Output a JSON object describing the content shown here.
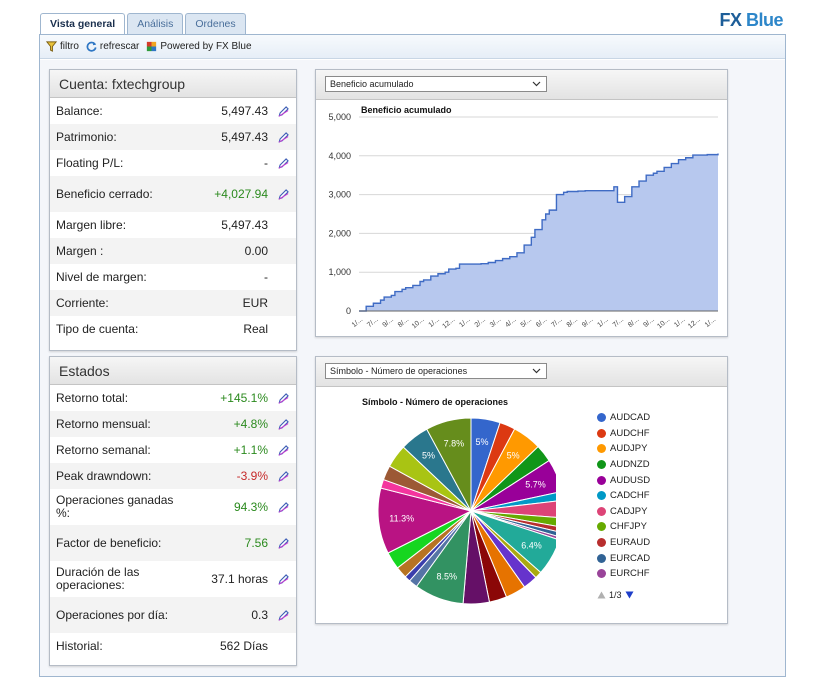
{
  "tabs": [
    {
      "label": "Vista general",
      "active": true
    },
    {
      "label": "Análisis",
      "active": false
    },
    {
      "label": "Ordenes",
      "active": false
    }
  ],
  "brand": {
    "prefix": "FX",
    "name": "Blue"
  },
  "toolbar": {
    "filter": "filtro",
    "refresh": "refrescar",
    "powered": "Powered by FX Blue"
  },
  "account": {
    "title": "Cuenta: fxtechgroup",
    "rows": [
      {
        "label": "Balance:",
        "value": "5,497.43",
        "tone": "",
        "icon": true
      },
      {
        "label": "Patrimonio:",
        "value": "5,497.43",
        "tone": "",
        "icon": true
      },
      {
        "label": "Floating P/L:",
        "value": "-",
        "tone": "",
        "icon": true
      },
      {
        "label": "Beneficio cerrado:",
        "value": "+4,027.94",
        "tone": "pos",
        "icon": true
      },
      {
        "label": "Margen libre:",
        "value": "5,497.43",
        "tone": "",
        "icon": false
      },
      {
        "label": "Margen :",
        "value": "0.00",
        "tone": "",
        "icon": false
      },
      {
        "label": "Nivel de margen:",
        "value": "-",
        "tone": "",
        "icon": false
      },
      {
        "label": "Corriente:",
        "value": "EUR",
        "tone": "",
        "icon": false
      },
      {
        "label": "Tipo de cuenta:",
        "value": "Real",
        "tone": "",
        "icon": false
      }
    ]
  },
  "stats": {
    "title": "Estados",
    "rows": [
      {
        "label": "Retorno total:",
        "value": "+145.1%",
        "tone": "pos",
        "icon": true
      },
      {
        "label": "Retorno mensual:",
        "value": "+4.8%",
        "tone": "pos",
        "icon": true
      },
      {
        "label": "Retorno semanal:",
        "value": "+1.1%",
        "tone": "pos",
        "icon": true
      },
      {
        "label": "Peak drawndown:",
        "value": "-3.9%",
        "tone": "neg",
        "icon": true
      },
      {
        "label": "Operaciones ganadas %:",
        "value": "94.3%",
        "tone": "pos",
        "icon": true
      },
      {
        "label": "Factor de beneficio:",
        "value": "7.56",
        "tone": "pos",
        "icon": true
      },
      {
        "label": "Duración de las operaciones:",
        "value": "37.1 horas",
        "tone": "",
        "icon": true
      },
      {
        "label": "Operaciones por día:",
        "value": "0.3",
        "tone": "",
        "icon": true
      },
      {
        "label": "Historial:",
        "value": "562 Días",
        "tone": "",
        "icon": false
      }
    ]
  },
  "area_panel": {
    "select": "Beneficio acumulado"
  },
  "pie_panel": {
    "select": "Símbolo - Número de operaciones",
    "pager": "1/3"
  },
  "colors": {
    "line": "#3f6bc4",
    "fill": "#b7c8ee",
    "grid": "#d7d7d7"
  },
  "chart_data": [
    {
      "type": "area",
      "title": "Beneficio acumulado",
      "ylim": [
        0,
        5000
      ],
      "yticks": [
        0,
        1000,
        2000,
        3000,
        4000,
        5000
      ],
      "ytick_labels": [
        "0",
        "1,000",
        "2,000",
        "3,000",
        "4,000",
        "5,000"
      ],
      "xtick_labels": [
        "1/...",
        "7/...",
        "9/...",
        "8/...",
        "10...",
        "1/...",
        "12...",
        "1/...",
        "2/...",
        "3/...",
        "4/...",
        "5/...",
        "6/...",
        "7/...",
        "8/...",
        "9/...",
        "1/...",
        "7/...",
        "8/...",
        "9/...",
        "10...",
        "1/...",
        "12...",
        "1/..."
      ],
      "grid": true,
      "x": [
        0,
        2,
        4,
        6,
        7,
        9,
        10,
        12,
        13,
        15,
        17,
        18,
        20,
        22,
        24,
        25,
        27,
        28,
        30,
        32,
        34,
        36,
        38,
        40,
        42,
        44,
        46,
        48,
        49,
        51,
        52,
        53,
        55,
        57,
        58,
        60,
        61,
        63,
        65,
        67,
        68,
        70,
        71,
        72,
        74,
        76,
        78,
        80,
        82,
        83,
        85,
        87,
        89,
        91,
        93,
        95,
        97,
        99,
        100
      ],
      "y": [
        0,
        120,
        200,
        280,
        360,
        400,
        500,
        560,
        600,
        660,
        760,
        800,
        900,
        960,
        1000,
        1080,
        1100,
        1210,
        1210,
        1210,
        1220,
        1250,
        1300,
        1350,
        1400,
        1500,
        1700,
        1900,
        2100,
        2350,
        2500,
        2600,
        3000,
        3060,
        3080,
        3080,
        3090,
        3100,
        3100,
        3100,
        3100,
        3100,
        3200,
        2800,
        2950,
        3200,
        3350,
        3500,
        3550,
        3600,
        3700,
        3800,
        3900,
        3950,
        4020,
        4020,
        4030,
        4030,
        4060
      ]
    },
    {
      "type": "pie",
      "title": "Símbolo - Número de operaciones",
      "legend": "right",
      "legend_entries": [
        "AUDCAD",
        "AUDCHF",
        "AUDJPY",
        "AUDNZD",
        "AUDUSD",
        "CADCHF",
        "CADJPY",
        "CHFJPY",
        "EURAUD",
        "EURCAD",
        "EURCHF"
      ],
      "slices": [
        {
          "value": 5.0,
          "label": "5%",
          "color": "#3466cc"
        },
        {
          "value": 2.7,
          "label": "",
          "color": "#dc3912"
        },
        {
          "value": 5.0,
          "label": "5%",
          "color": "#ff9900"
        },
        {
          "value": 3.0,
          "label": "",
          "color": "#109618"
        },
        {
          "value": 5.7,
          "label": "5.7%",
          "color": "#990099"
        },
        {
          "value": 1.5,
          "label": "",
          "color": "#0099c6"
        },
        {
          "value": 3.0,
          "label": "",
          "color": "#dd4477"
        },
        {
          "value": 1.6,
          "label": "",
          "color": "#66aa00"
        },
        {
          "value": 0.9,
          "label": "",
          "color": "#b82e2e"
        },
        {
          "value": 0.8,
          "label": "",
          "color": "#316395"
        },
        {
          "value": 0.5,
          "label": "",
          "color": "#994499"
        },
        {
          "value": 6.4,
          "label": "6.4%",
          "color": "#22aa99"
        },
        {
          "value": 1.2,
          "label": "",
          "color": "#aaaa11"
        },
        {
          "value": 2.5,
          "label": "",
          "color": "#6633cc"
        },
        {
          "value": 3.5,
          "label": "",
          "color": "#e67300"
        },
        {
          "value": 3.0,
          "label": "",
          "color": "#8b0707"
        },
        {
          "value": 4.5,
          "label": "",
          "color": "#651067"
        },
        {
          "value": 8.5,
          "label": "8.5%",
          "color": "#329262"
        },
        {
          "value": 1.5,
          "label": "",
          "color": "#5574a6"
        },
        {
          "value": 1.0,
          "label": "",
          "color": "#3b3eac"
        },
        {
          "value": 2.0,
          "label": "",
          "color": "#b77322"
        },
        {
          "value": 3.0,
          "label": "",
          "color": "#16d620"
        },
        {
          "value": 11.3,
          "label": "11.3%",
          "color": "#b91383"
        },
        {
          "value": 1.5,
          "label": "",
          "color": "#f4359e"
        },
        {
          "value": 2.5,
          "label": "",
          "color": "#9c5935"
        },
        {
          "value": 4.0,
          "label": "",
          "color": "#a9c413"
        },
        {
          "value": 5.0,
          "label": "5%",
          "color": "#2a778d"
        },
        {
          "value": 7.8,
          "label": "7.8%",
          "color": "#668d1c"
        }
      ]
    }
  ]
}
